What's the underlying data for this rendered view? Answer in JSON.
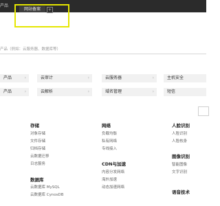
{
  "browser": {
    "left_fragment": "产品",
    "active_tab": "网站备案",
    "new_tab": "+"
  },
  "search": {
    "placeholder": "产品（例如：云服务器、数据库等）"
  },
  "grid": {
    "row1": [
      "产品",
      "云审计",
      "云服务器",
      "主机安全"
    ],
    "row2": [
      "产品",
      "云解析",
      "域名管理",
      "短信"
    ]
  },
  "columns": {
    "storage": {
      "title": "存储",
      "items": [
        "对象存储",
        "文件存储",
        "归档存储",
        "云数据迁移",
        "日志服务"
      ]
    },
    "database": {
      "title": "数据库",
      "items": [
        "云数据库 MySQL",
        "云数据库 CynosDB"
      ]
    },
    "network": {
      "title": "网络",
      "items": [
        "负载均衡",
        "私有网络",
        "专线接入"
      ]
    },
    "cdn": {
      "title": "CDN与加速",
      "items": [
        "内容分发网络",
        "海外加速",
        "动态加速网络"
      ]
    },
    "face": {
      "title": "人脸识别",
      "items": [
        "人脸识别",
        "人脸核身"
      ]
    },
    "image": {
      "title": "图像识别",
      "items": [
        "智能图像",
        "文字识别"
      ]
    },
    "voice": {
      "title": "语音技术",
      "items": []
    }
  },
  "colors": {
    "highlight": "#e5e600",
    "topbar": "#2b2b2b"
  }
}
